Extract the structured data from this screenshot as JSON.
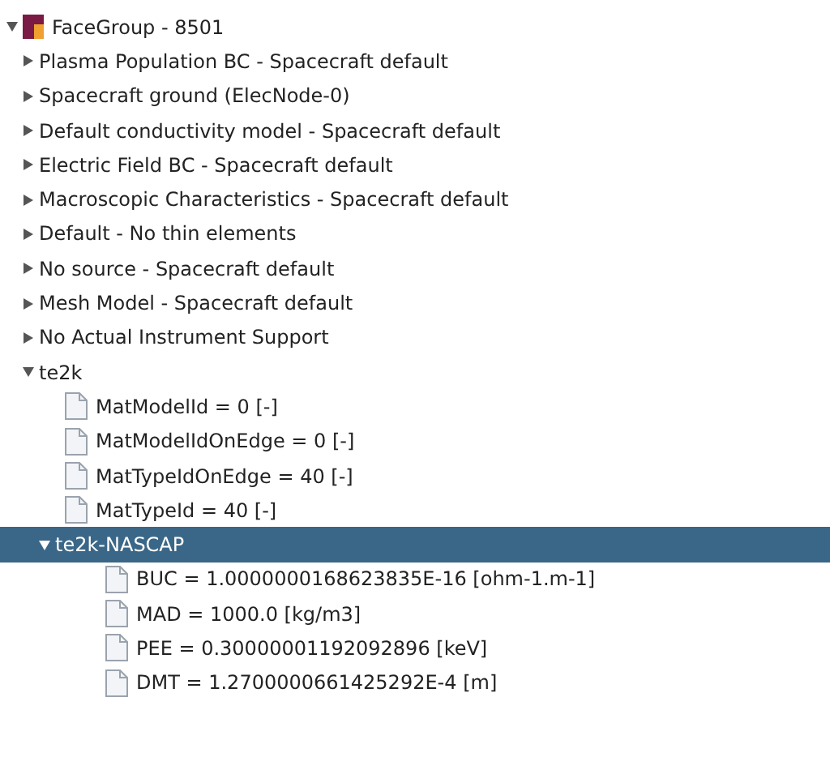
{
  "tree": [
    {
      "label": "FaceGroup - 8501",
      "kind": "group",
      "expanded": true,
      "selected": false,
      "children": [
        {
          "label": "Plasma Population BC - Spacecraft default",
          "kind": "folder",
          "expanded": false,
          "selected": false
        },
        {
          "label": "Spacecraft ground (ElecNode-0)",
          "kind": "folder",
          "expanded": false,
          "selected": false
        },
        {
          "label": "Default conductivity model - Spacecraft default",
          "kind": "folder",
          "expanded": false,
          "selected": false
        },
        {
          "label": "Electric Field BC - Spacecraft default",
          "kind": "folder",
          "expanded": false,
          "selected": false
        },
        {
          "label": "Macroscopic Characteristics - Spacecraft default",
          "kind": "folder",
          "expanded": false,
          "selected": false
        },
        {
          "label": "Default - No thin elements",
          "kind": "folder",
          "expanded": false,
          "selected": false
        },
        {
          "label": "No source - Spacecraft default",
          "kind": "folder",
          "expanded": false,
          "selected": false
        },
        {
          "label": "Mesh Model - Spacecraft default",
          "kind": "folder",
          "expanded": false,
          "selected": false
        },
        {
          "label": "No Actual Instrument Support",
          "kind": "folder",
          "expanded": false,
          "selected": false
        },
        {
          "label": "te2k",
          "kind": "folder",
          "expanded": true,
          "selected": false,
          "children": [
            {
              "label": "MatModelId = 0 [-]",
              "kind": "leaf",
              "selected": false
            },
            {
              "label": "MatModelIdOnEdge = 0 [-]",
              "kind": "leaf",
              "selected": false
            },
            {
              "label": "MatTypeIdOnEdge = 40 [-]",
              "kind": "leaf",
              "selected": false
            },
            {
              "label": "MatTypeId = 40 [-]",
              "kind": "leaf",
              "selected": false
            },
            {
              "label": "te2k-NASCAP",
              "kind": "folder",
              "expanded": true,
              "selected": true,
              "children": [
                {
                  "label": "BUC = 1.0000000168623835E-16 [ohm-1.m-1]",
                  "kind": "leaf",
                  "selected": false
                },
                {
                  "label": "MAD = 1000.0 [kg/m3]",
                  "kind": "leaf",
                  "selected": false
                },
                {
                  "label": "PEE = 0.30000001192092896 [keV]",
                  "kind": "leaf",
                  "selected": false
                },
                {
                  "label": "DMT = 1.2700000661425292E-4 [m]",
                  "kind": "leaf",
                  "selected": false
                }
              ]
            }
          ]
        }
      ]
    }
  ]
}
